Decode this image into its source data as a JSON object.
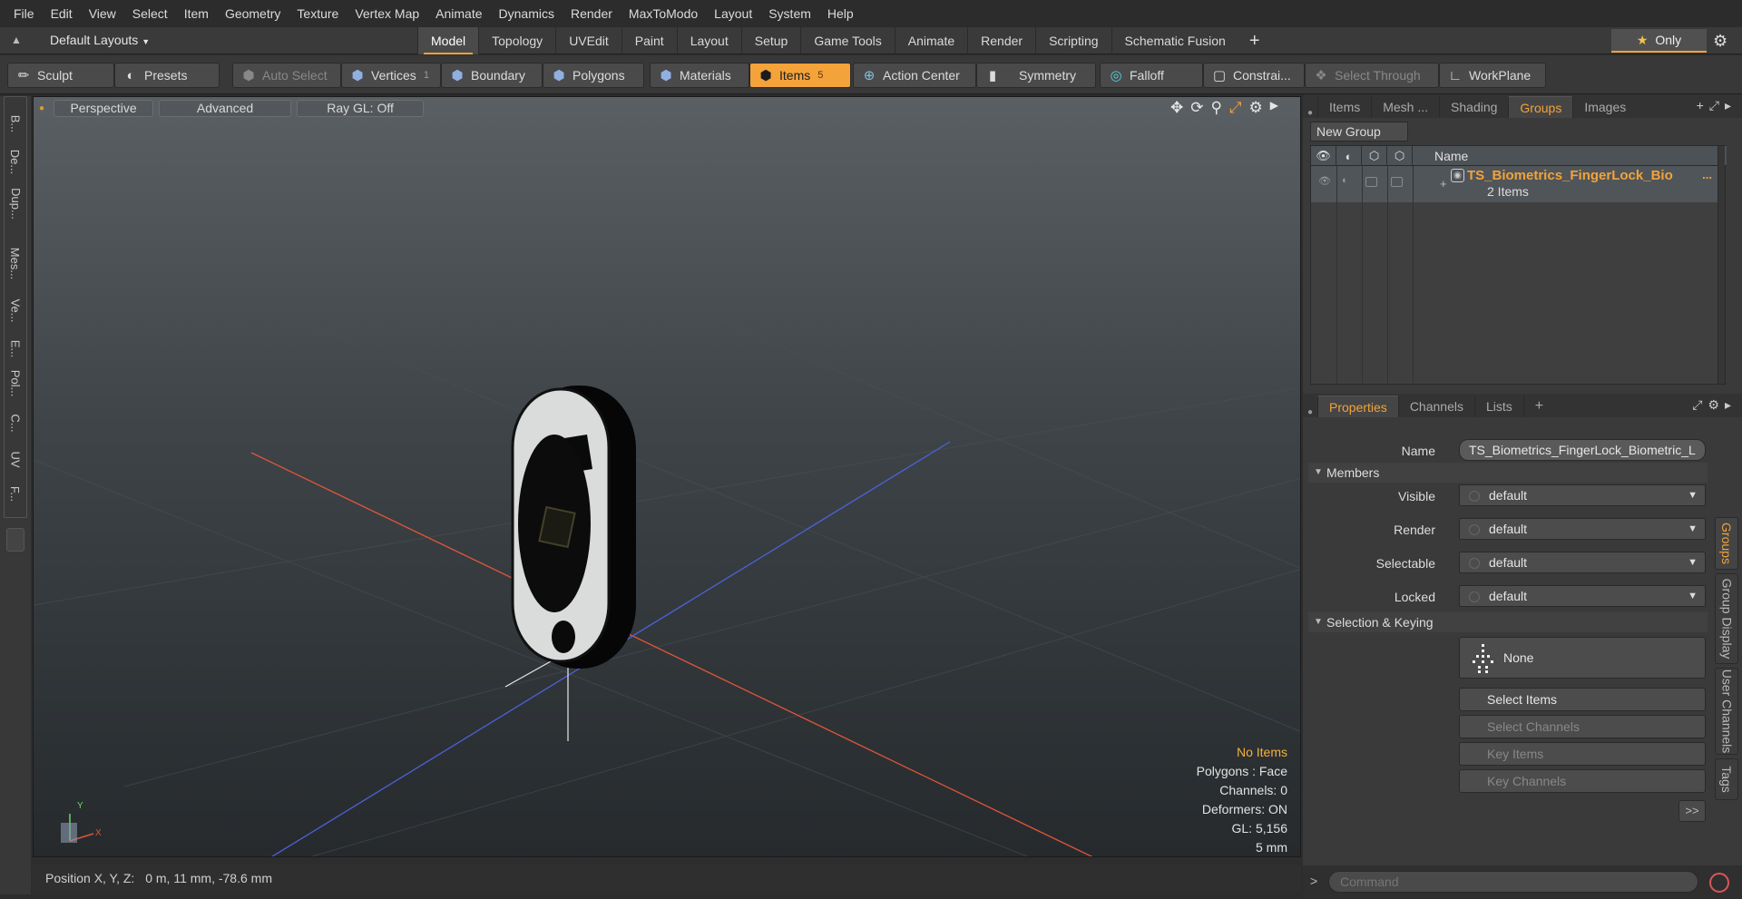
{
  "menu": [
    "File",
    "Edit",
    "View",
    "Select",
    "Item",
    "Geometry",
    "Texture",
    "Vertex Map",
    "Animate",
    "Dynamics",
    "Render",
    "MaxToModo",
    "Layout",
    "System",
    "Help"
  ],
  "layout_bar": {
    "layout_name": "Default Layouts",
    "tabs": [
      "Model",
      "Topology",
      "UVEdit",
      "Paint",
      "Layout",
      "Setup",
      "Game Tools",
      "Animate",
      "Render",
      "Scripting",
      "Schematic Fusion"
    ],
    "active_tab": "Model",
    "only_label": "Only"
  },
  "toolbar": {
    "sculpt": "Sculpt",
    "presets": "Presets",
    "auto_select": "Auto Select",
    "vertices": "Vertices",
    "vertices_count": "1",
    "boundary": "Boundary",
    "polygons": "Polygons",
    "materials": "Materials",
    "items": "Items",
    "items_count": "5",
    "action_center": "Action Center",
    "symmetry": "Symmetry",
    "falloff": "Falloff",
    "constraints": "Constrai...",
    "select_through": "Select Through",
    "workplane": "WorkPlane"
  },
  "viewport": {
    "view_mode": "Perspective",
    "shading": "Advanced",
    "raygl": "Ray GL: Off",
    "info": {
      "no_items": "No Items",
      "polygons": "Polygons : Face",
      "channels": "Channels: 0",
      "deformers": "Deformers: ON",
      "gl": "GL: 5,156",
      "scale": "5 mm"
    },
    "axis_labels": {
      "x": "X",
      "y": "Y",
      "z": "Z"
    }
  },
  "status": {
    "position_label": "Position X, Y, Z:",
    "position_value": "0 m, 11 mm, -78.6 mm"
  },
  "left_tabs": [
    "B...",
    "De...",
    "Dup...",
    "Mes...",
    "Ve...",
    "E...",
    "Pol...",
    "C...",
    "UV",
    "F..."
  ],
  "top_panel": {
    "tabs": [
      "Items",
      "Mesh ...",
      "Shading",
      "Groups",
      "Images"
    ],
    "active_tab": "Groups",
    "new_group": "New Group",
    "name_header": "Name",
    "group": {
      "name": "TS_Biometrics_FingerLock_Bio",
      "more": "...",
      "count": "2 Items"
    }
  },
  "properties_panel": {
    "tabs": [
      "Properties",
      "Channels",
      "Lists"
    ],
    "active_tab": "Properties",
    "name_label": "Name",
    "name_value": "TS_Biometrics_FingerLock_Biometric_L",
    "members_section": "Members",
    "fields": [
      {
        "label": "Visible",
        "value": "default"
      },
      {
        "label": "Render",
        "value": "default"
      },
      {
        "label": "Selectable",
        "value": "default"
      },
      {
        "label": "Locked",
        "value": "default"
      }
    ],
    "selection_section": "Selection & Keying",
    "none_label": "None",
    "select_items": "Select Items",
    "select_channels": "Select Channels",
    "key_items": "Key Items",
    "key_channels": "Key Channels",
    "more": ">>",
    "vertical_tabs": [
      "Groups",
      "Group Display",
      "User Channels",
      "Tags"
    ]
  },
  "command": {
    "prompt": ">",
    "placeholder": "Command"
  },
  "colors": {
    "accent": "#f2a33a",
    "x_axis": "#e0553a",
    "z_axis": "#4a63d8"
  }
}
